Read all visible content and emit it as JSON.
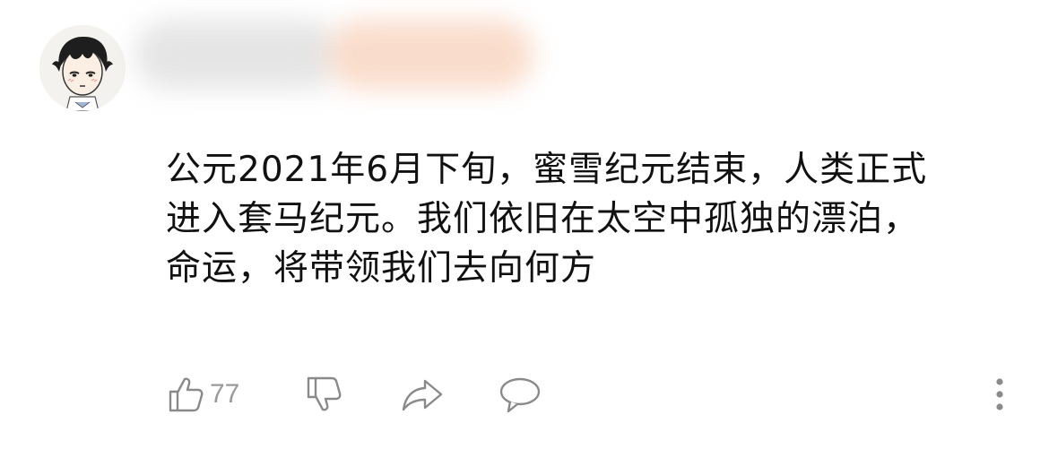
{
  "comment": {
    "lines": [
      "公元2021年6月下旬，蜜雪纪元结束，人类正式",
      "进入套马纪元。我们依旧在太空中孤独的漂泊，",
      "命运，将带领我们去向何方"
    ]
  },
  "actions": {
    "like_count": "77",
    "icons": [
      "thumbs-up-icon",
      "thumbs-down-icon",
      "share-arrow-icon",
      "comment-bubble-icon",
      "more-vertical-icon"
    ]
  },
  "colors": {
    "text": "#111111",
    "icon": "#8a8a8a",
    "count": "#9a9a9a",
    "name_blur_gray": "#e3e3e3",
    "name_blur_peach": "#f9d9c6"
  }
}
